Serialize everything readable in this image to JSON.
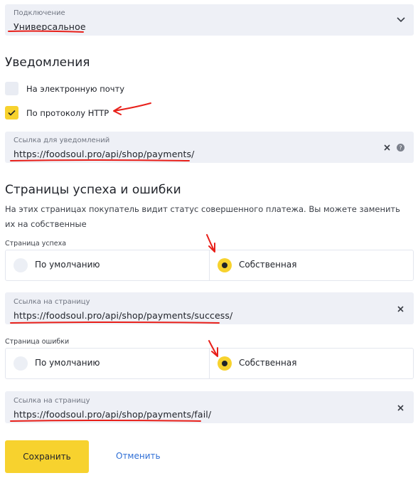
{
  "connection": {
    "label": "Подключение",
    "value": "Универсальное"
  },
  "notifications": {
    "heading": "Уведомления",
    "options": [
      {
        "label": "На электронную почту",
        "checked": false
      },
      {
        "label": "По протоколу HTTP",
        "checked": true
      }
    ],
    "url_field": {
      "label": "Ссылка для уведомлений",
      "value": "https://foodsoul.pro/api/shop/payments/"
    }
  },
  "pages": {
    "heading": "Страницы успеха и ошибки",
    "description": "На этих страницах покупатель видит статус совершенного платежа. Вы можете заменить их на собственные",
    "success": {
      "label": "Страница успеха",
      "options": [
        "По умолчанию",
        "Собственная"
      ],
      "selected": 1,
      "url_label": "Ссылка на страницу",
      "url_value": "https://foodsoul.pro/api/shop/payments/success/"
    },
    "fail": {
      "label": "Страница ошибки",
      "options": [
        "По умолчанию",
        "Собственная"
      ],
      "selected": 1,
      "url_label": "Ссылка на страницу",
      "url_value": "https://foodsoul.pro/api/shop/payments/fail/"
    }
  },
  "actions": {
    "save": "Сохранить",
    "cancel": "Отменить"
  },
  "colors": {
    "accent": "#f7d22e",
    "field_bg": "#eef0f6",
    "link": "#2f6fd6",
    "annotation": "#e8201a"
  },
  "icons": {
    "dropdown": "chevron-down-icon",
    "clear": "close-icon",
    "help": "question-circle-icon"
  }
}
